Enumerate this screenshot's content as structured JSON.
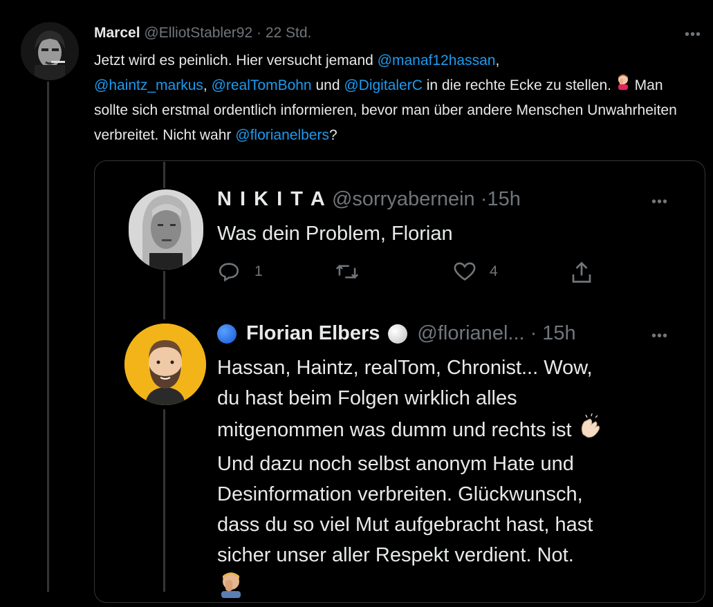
{
  "outer_tweet": {
    "display_name": "Marcel",
    "handle": "@ElliotStabler92",
    "separator": "·",
    "time": "22 Std.",
    "text_1": "Jetzt wird es peinlich. Hier versucht jemand ",
    "mention_1": "@manaf12hassan",
    "text_2": ",",
    "mention_2": "@haintz_markus",
    "text_3": ", ",
    "mention_3": "@realTomBohn",
    "text_4": " und ",
    "mention_4": "@DigitalerC",
    "text_5": " in die rechte Ecke zu stellen. ",
    "text_6": " Man sollte sich erstmal ordentlich informieren, bevor man über andere Menschen Unwahrheiten verbreitet. Nicht wahr ",
    "mention_5": "@florianelbers",
    "text_7": "?"
  },
  "quoted_tweet_1": {
    "display_name": "N I K I T A",
    "handle": "@sorryabernein",
    "separator": "·",
    "time": "15h",
    "text": "Was dein Problem, Florian",
    "reply_count": "1",
    "like_count": "4"
  },
  "quoted_tweet_2": {
    "display_name": "Florian Elbers",
    "handle": "@florianel...",
    "separator": "·",
    "time": "15h",
    "line_1": "Hassan, Haintz, realTom, Chronist... Wow,",
    "line_2": "du hast beim Folgen wirklich alles",
    "line_3": "mitgenommen was dumm und rechts ist",
    "line_4": "Und dazu noch selbst anonym Hate und",
    "line_5": "Desinformation verbreiten. Glückwunsch,",
    "line_6": "dass du so viel Mut aufgebracht hast, hast",
    "line_7": "sicher unser aller Respekt verdient. Not."
  },
  "colors": {
    "background": "#000000",
    "text": "#e7e9ea",
    "muted": "#71767b",
    "mention": "#1d9bf0",
    "border": "#333639"
  }
}
